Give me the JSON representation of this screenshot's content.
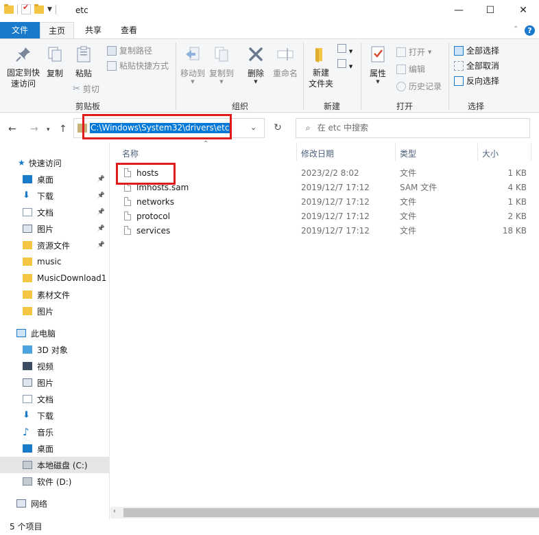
{
  "window": {
    "title": "etc"
  },
  "controls": {
    "minimize": "—",
    "maximize": "☐",
    "close": "✕"
  },
  "tabs": [
    {
      "label": "文件"
    },
    {
      "label": "主页"
    },
    {
      "label": "共享"
    },
    {
      "label": "查看"
    }
  ],
  "ribbon": {
    "clipboard": {
      "pin": "固定到快速访问",
      "pin_l1": "固定到快",
      "pin_l2": "速访问",
      "copy": "复制",
      "paste": "粘贴",
      "copy_path": "复制路径",
      "paste_shortcut": "粘贴快捷方式",
      "cut": "剪切",
      "group": "剪贴板"
    },
    "organize": {
      "move_to": "移动到",
      "copy_to": "复制到",
      "delete": "删除",
      "rename": "重命名",
      "group": "组织"
    },
    "new": {
      "new_folder_l1": "新建",
      "new_folder_l2": "文件夹",
      "group": "新建"
    },
    "open": {
      "properties": "属性",
      "open": "打开",
      "edit": "编辑",
      "history": "历史记录",
      "group": "打开"
    },
    "select": {
      "select_all": "全部选择",
      "select_none": "全部取消",
      "invert": "反向选择",
      "group": "选择"
    }
  },
  "address": {
    "path": "C:\\Windows\\System32\\drivers\\etc",
    "search_placeholder": "在 etc 中搜索"
  },
  "nav": {
    "quick_access": "快速访问",
    "qa_items": [
      {
        "label": "桌面",
        "pinned": true
      },
      {
        "label": "下载",
        "pinned": true
      },
      {
        "label": "文档",
        "pinned": true
      },
      {
        "label": "图片",
        "pinned": true
      },
      {
        "label": "资源文件",
        "pinned": true
      },
      {
        "label": "music",
        "pinned": false
      },
      {
        "label": "MusicDownload1",
        "pinned": false
      },
      {
        "label": "素材文件",
        "pinned": false
      },
      {
        "label": "图片",
        "pinned": false
      }
    ],
    "this_pc": "此电脑",
    "pc_items": [
      {
        "label": "3D 对象"
      },
      {
        "label": "视频"
      },
      {
        "label": "图片"
      },
      {
        "label": "文档"
      },
      {
        "label": "下载"
      },
      {
        "label": "音乐"
      },
      {
        "label": "桌面"
      },
      {
        "label": "本地磁盘 (C:)"
      },
      {
        "label": "软件 (D:)"
      }
    ],
    "network": "网络"
  },
  "columns": {
    "name": "名称",
    "date": "修改日期",
    "type": "类型",
    "size": "大小"
  },
  "files": [
    {
      "name": "hosts",
      "date": "2023/2/2 8:02",
      "type": "文件",
      "size": "1 KB"
    },
    {
      "name": "lmhosts.sam",
      "date": "2019/12/7 17:12",
      "type": "SAM 文件",
      "size": "4 KB"
    },
    {
      "name": "networks",
      "date": "2019/12/7 17:12",
      "type": "文件",
      "size": "1 KB"
    },
    {
      "name": "protocol",
      "date": "2019/12/7 17:12",
      "type": "文件",
      "size": "2 KB"
    },
    {
      "name": "services",
      "date": "2019/12/7 17:12",
      "type": "文件",
      "size": "18 KB"
    }
  ],
  "status": {
    "count": "5 个项目"
  },
  "accent": "#1979ca",
  "highlight": "#e01a1a"
}
